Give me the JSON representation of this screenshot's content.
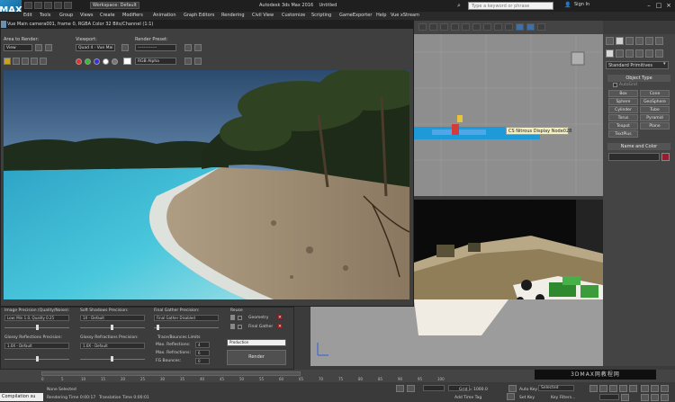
{
  "app": {
    "logo_label": "MAX",
    "title": "Autodesk 3ds Max 2016",
    "doc": "Untitled",
    "workspace": "Workspace: Default",
    "search_placeholder": "Type a keyword or phrase",
    "sign_in": "Sign In"
  },
  "menu": [
    "Edit",
    "Tools",
    "Group",
    "Views",
    "Create",
    "Modifiers",
    "Animation",
    "Graph Editors",
    "Rendering",
    "Civil View",
    "Customize",
    "Scripting",
    "GameExporter",
    "Help",
    "Vue xStream"
  ],
  "render_frame": {
    "title": "Vue Main camera001, frame 0, RGBA Color 32 Bits/Channel (1:1)",
    "area_label": "Area to Render:",
    "area_value": "View",
    "viewport_label": "Viewport:",
    "viewport_value": "Quad 4 - Vue Mai",
    "preset_label": "Render Preset:",
    "preset_value": "-------------",
    "channel_value": "RGB Alpha"
  },
  "render_settings": {
    "image_precision_label": "Image Precision (Quality/Noise):",
    "image_precision_value": "Low: Min 1.0, Quality 0.25",
    "soft_shadows_label": "Soft Shadows Precision:",
    "soft_shadows_value": "1X - Default",
    "final_gather_label": "Final Gather Precision:",
    "final_gather_value": "Final Gather Disabled",
    "reuse_label": "Reuse",
    "geometry_label": "Geometry",
    "final_gather_cb_label": "Final Gather",
    "glossy_refl_label": "Glossy Reflections Precision:",
    "glossy_refl_value": "1.0X - Default",
    "glossy_refr_label": "Glossy Refractions Precision:",
    "glossy_refr_value": "1.0X - Default",
    "trace_label": "Trace/Bounces Limits",
    "max_reflections_label": "Max. Reflections:",
    "max_reflections_value": "4",
    "max_refractions_label": "Max. Refractions:",
    "max_refractions_value": "6",
    "fg_bounces_label": "FG Bounces:",
    "fg_bounces_value": "0",
    "production_value": "Production",
    "render_button": "Render"
  },
  "command_panel": {
    "dropdown": "Standard Primitives",
    "object_type_header": "Object Type",
    "autogrid": "AutoGrid",
    "buttons": [
      "Box",
      "Cone",
      "Sphere",
      "GeoSphere",
      "Cylinder",
      "Tube",
      "Torus",
      "Pyramid",
      "Teapot",
      "Plane",
      "TextPlus"
    ],
    "name_color_header": "Name and Color",
    "swatch_color": "#9a1a2e"
  },
  "viewport": {
    "tooltip": "CS Nitrous Display Node028"
  },
  "timeline": {
    "ticks": [
      "0",
      "5",
      "10",
      "15",
      "20",
      "25",
      "30",
      "35",
      "40",
      "45",
      "50",
      "55",
      "60",
      "65",
      "70",
      "75",
      "80",
      "85",
      "90",
      "95",
      "100"
    ]
  },
  "status": {
    "maxscript": "Compilation su",
    "none_selected": "None Selected",
    "rendering_time": "Rendering Time 0:00:17",
    "translation_time": "Translation Time 0:00:01",
    "grid": "Grid = 1000.0",
    "auto_key": "Auto Key",
    "selected": "Selected",
    "set_key": "Set Key",
    "key_filters": "Key Filters...",
    "add_time_tag": "Add Time Tag",
    "watermark": "3DMAX网教程网"
  }
}
